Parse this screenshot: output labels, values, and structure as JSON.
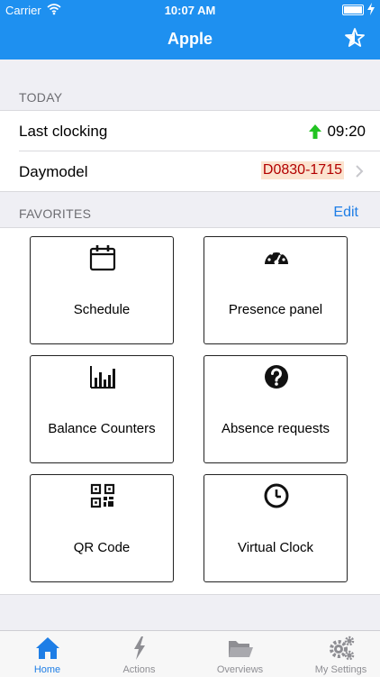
{
  "status_bar": {
    "carrier": "Carrier",
    "time": "10:07 AM"
  },
  "nav": {
    "title": "Apple",
    "accent_color": "#1e90f0"
  },
  "today": {
    "header": "TODAY",
    "last_clocking": {
      "label": "Last clocking",
      "value": "09:20",
      "direction_icon": "arrow-up-icon",
      "color": "#22c322"
    },
    "daymodel": {
      "label": "Daymodel",
      "value": "D0830-1715",
      "color": "#b30000",
      "highlight": "#fbe3cf"
    }
  },
  "favorites": {
    "header": "FAVORITES",
    "edit_label": "Edit",
    "tiles": [
      {
        "label": "Schedule",
        "icon": "calendar-icon"
      },
      {
        "label": "Presence panel",
        "icon": "speedometer-icon"
      },
      {
        "label": "Balance Counters",
        "icon": "bar-chart-icon"
      },
      {
        "label": "Absence requests",
        "icon": "question-icon"
      },
      {
        "label": "QR Code",
        "icon": "qr-code-icon"
      },
      {
        "label": "Virtual Clock",
        "icon": "clock-icon"
      }
    ]
  },
  "tabbar": {
    "active": "Home",
    "tabs": [
      {
        "label": "Home",
        "icon": "home-icon"
      },
      {
        "label": "Actions",
        "icon": "lightning-icon"
      },
      {
        "label": "Overviews",
        "icon": "folder-icon"
      },
      {
        "label": "My Settings",
        "icon": "gears-icon"
      }
    ]
  }
}
